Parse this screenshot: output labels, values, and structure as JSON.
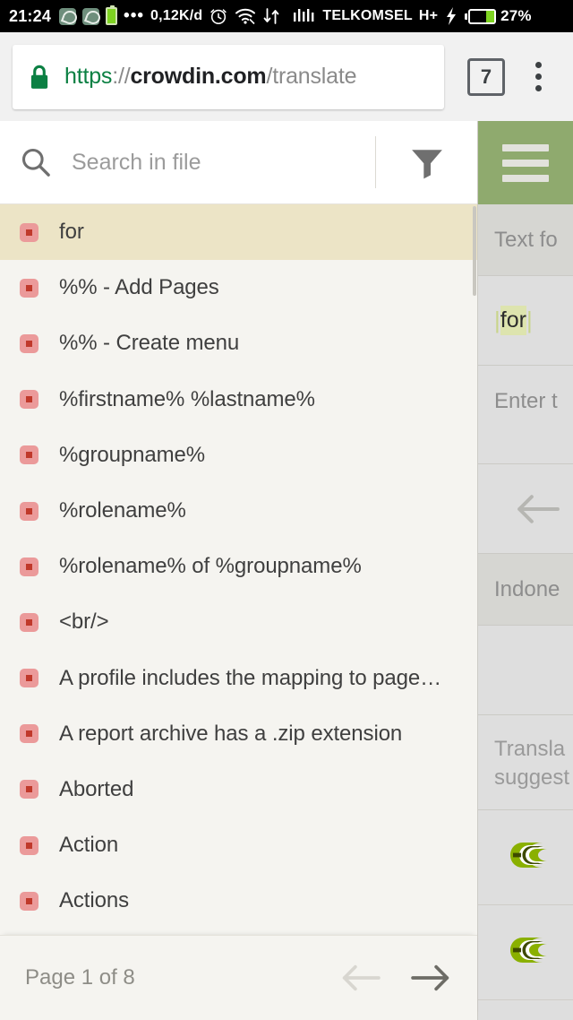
{
  "statusbar": {
    "time": "21:24",
    "whatsapp_icon": "whatsapp-icon",
    "battery_app_icon": "battery-app-icon",
    "overflow_dots": "•••",
    "data_rate": "0,12K/d",
    "alarm_icon": "alarm-clock-icon",
    "wifi_icon": "wifi-icon",
    "data_transfer_icon": "data-transfer-icon",
    "signal_icon": "signal-bars-icon",
    "carrier": "TELKOMSEL",
    "network_type": "H+",
    "charging_icon": "charging-bolt-icon",
    "battery_icon": "battery-icon",
    "battery_percent": "27%"
  },
  "browser": {
    "lock_icon": "lock-icon",
    "url_scheme": "https",
    "url_separator": "://",
    "url_host": "crowdin.com",
    "url_path": "/translate",
    "tab_count": "7",
    "menu_icon": "overflow-menu-icon"
  },
  "search": {
    "icon": "search-icon",
    "placeholder": "Search in file",
    "value": "",
    "filter_icon": "filter-funnel-icon"
  },
  "menu": {
    "hamburger_icon": "hamburger-menu-icon"
  },
  "file_list": {
    "items": [
      {
        "label": "for",
        "status": "untranslated",
        "selected": true
      },
      {
        "label": "%% - Add Pages",
        "status": "untranslated",
        "selected": false
      },
      {
        "label": "%% - Create menu",
        "status": "untranslated",
        "selected": false
      },
      {
        "label": "%firstname% %lastname%",
        "status": "untranslated",
        "selected": false
      },
      {
        "label": "%groupname%",
        "status": "untranslated",
        "selected": false
      },
      {
        "label": "%rolename%",
        "status": "untranslated",
        "selected": false
      },
      {
        "label": "%rolename% of %groupname%",
        "status": "untranslated",
        "selected": false
      },
      {
        "label": "<br/>",
        "status": "untranslated",
        "selected": false
      },
      {
        "label": "A profile includes the mapping to page…",
        "status": "untranslated",
        "selected": false
      },
      {
        "label": "A report archive has a .zip extension",
        "status": "untranslated",
        "selected": false
      },
      {
        "label": "Aborted",
        "status": "untranslated",
        "selected": false
      },
      {
        "label": "Action",
        "status": "untranslated",
        "selected": false
      },
      {
        "label": "Actions",
        "status": "untranslated",
        "selected": false
      }
    ]
  },
  "footer": {
    "page_indicator": "Page 1 of 8",
    "prev_icon": "arrow-left-icon",
    "next_icon": "arrow-right-icon"
  },
  "right_panel": {
    "source_header": "Text fo",
    "source_text": "for",
    "target_placeholder": "Enter t",
    "back_icon": "arrow-left-icon",
    "language": "Indone",
    "suggestions_header": "Transla\nsuggest",
    "suggestions_header_line1": "Transla",
    "suggestions_header_line2": "suggest",
    "suggestion_rows": [
      {
        "icon": "crowdin-logo-icon"
      },
      {
        "icon": "crowdin-logo-icon"
      }
    ]
  },
  "colors": {
    "brand_green": "#8faa6e",
    "selected_row": "#ece4c6",
    "list_bg": "#f5f4f0",
    "status_dot": "#c0392b",
    "status_chip": "#eb9a9a",
    "highlight": "#dde4ae",
    "secure_green": "#0b8043"
  }
}
